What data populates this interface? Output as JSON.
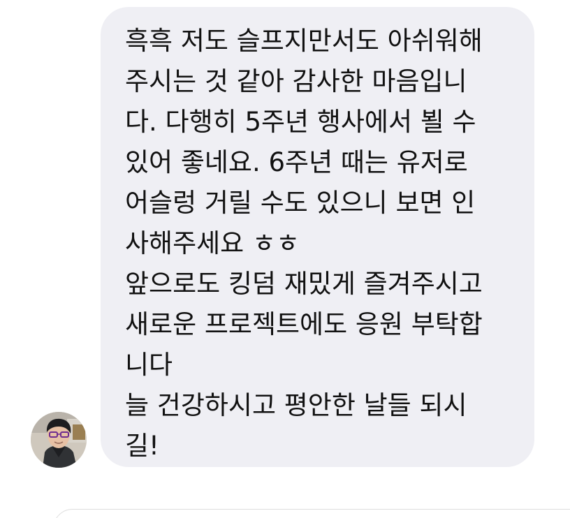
{
  "conversation": {
    "message": {
      "lines": [
        "흑흑 저도 슬프지만서도 아쉬워해",
        "주시는 것 같아 감사한 마음입니",
        "다. 다행히 5주년 행사에서 뵐 수",
        "있어 좋네요. 6주년 때는 유저로",
        "어슬렁 거릴 수도 있으니 보면 인",
        "사해주세요 ㅎㅎ",
        "앞으로도 킹덤 재밌게 즐겨주시고",
        "새로운 프로젝트에도 응원 부탁합",
        "니다",
        "늘 건강하시고 평안한 날들 되시",
        "길!"
      ]
    }
  },
  "colors": {
    "background": "#ffffff",
    "bubble": "#efeff4",
    "text": "#111111",
    "composer_border": "#dedede"
  }
}
